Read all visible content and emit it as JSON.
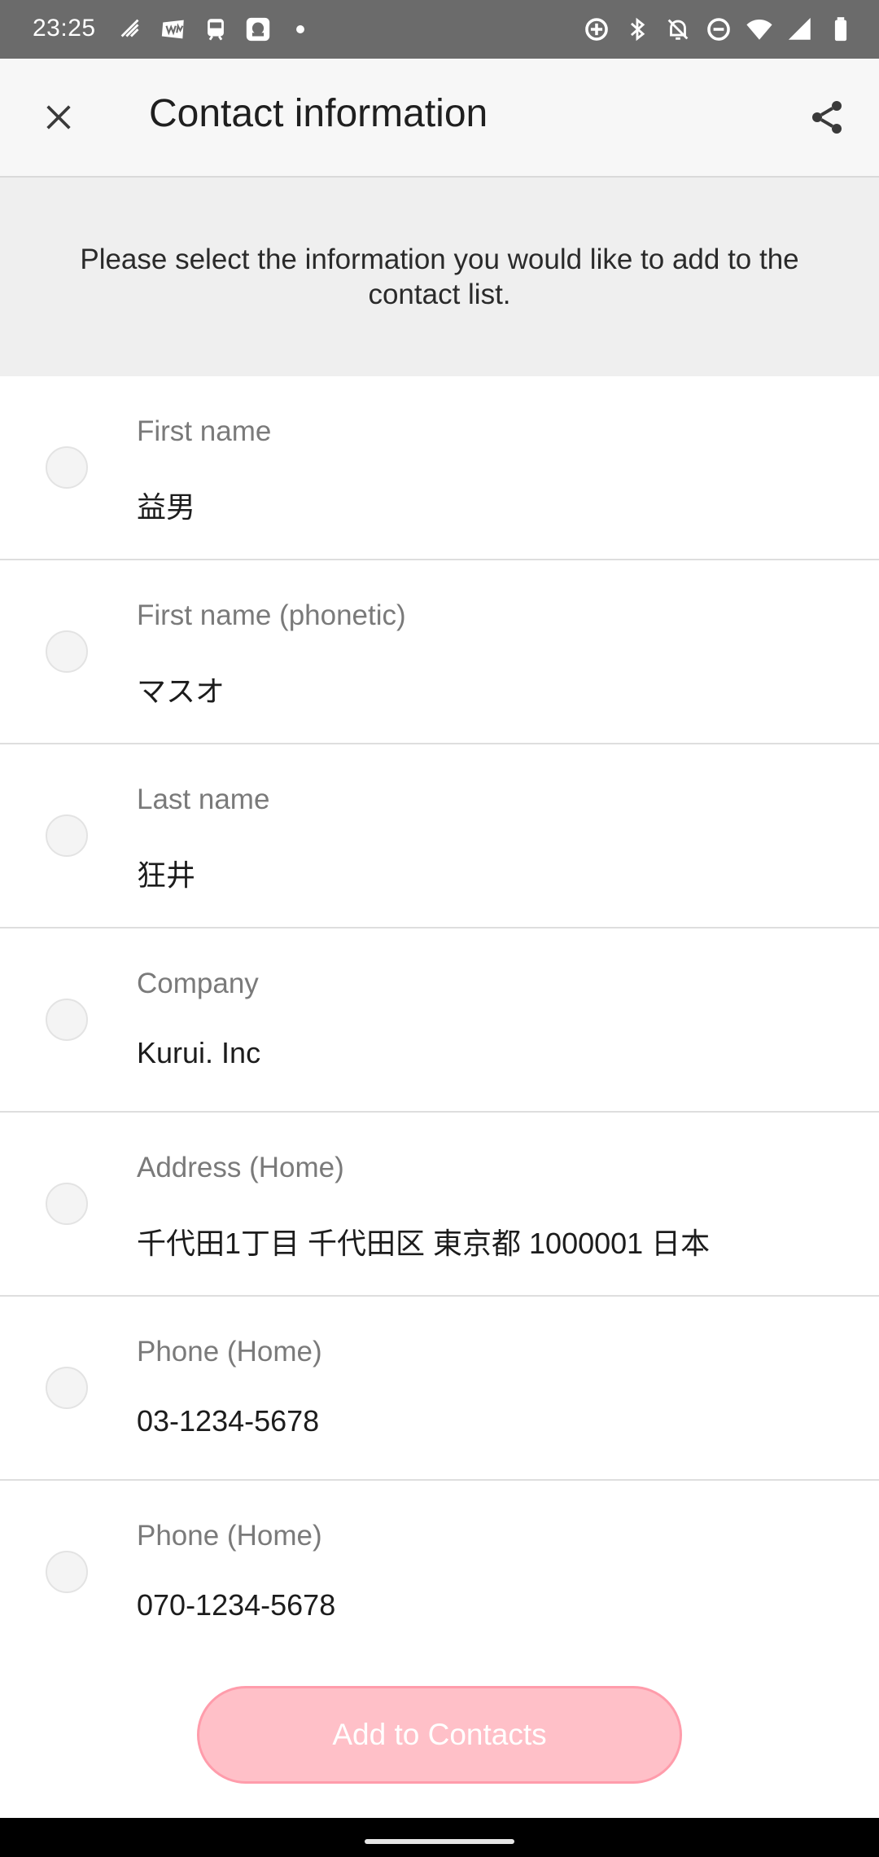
{
  "status_bar": {
    "time": "23:25",
    "left_icons": [
      "signal-bars-icon",
      "wm-badge-icon",
      "train-icon",
      "app-square-icon",
      "dot-icon"
    ],
    "right_icons": [
      "data-saver-icon",
      "bluetooth-icon",
      "notifications-off-icon",
      "do-not-disturb-icon",
      "wifi-icon",
      "cell-signal-icon",
      "battery-icon"
    ]
  },
  "app_bar": {
    "title": "Contact information",
    "close_icon": "close-icon",
    "share_icon": "share-icon"
  },
  "banner": {
    "text": "Please select the information you would like to add to the contact list."
  },
  "fields": [
    {
      "label": "First name",
      "value": "益男"
    },
    {
      "label": "First name (phonetic)",
      "value": "マスオ"
    },
    {
      "label": "Last name",
      "value": "狂井"
    },
    {
      "label": "Company",
      "value": "Kurui. Inc"
    },
    {
      "label": "Address (Home)",
      "value": "千代田1丁目  千代田区 東京都 1000001 日本"
    },
    {
      "label": "Phone (Home)",
      "value": "03-1234-5678"
    },
    {
      "label": "Phone (Home)",
      "value": "070-1234-5678"
    }
  ],
  "actions": {
    "add_to_contacts": "Add to Contacts"
  },
  "colors": {
    "status_bar": "#6b6b6b",
    "app_bar": "#f7f7f7",
    "banner": "#efefef",
    "button_fill": "#ffc0c8",
    "button_border": "#ff9cab"
  }
}
